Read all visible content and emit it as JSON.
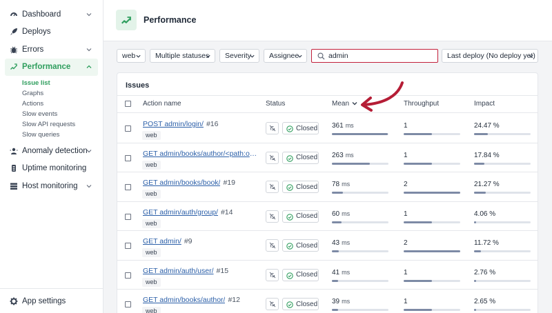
{
  "sidebar": {
    "items": [
      {
        "key": "dashboard",
        "label": "Dashboard",
        "icon": "dashboard-icon",
        "chevron": "down"
      },
      {
        "key": "deploys",
        "label": "Deploys",
        "icon": "rocket-icon",
        "chevron": ""
      },
      {
        "key": "errors",
        "label": "Errors",
        "icon": "bug-icon",
        "chevron": "down"
      },
      {
        "key": "performance",
        "label": "Performance",
        "icon": "performance-icon",
        "chevron": "up",
        "active": true
      },
      {
        "key": "anomaly",
        "label": "Anomaly detection",
        "icon": "anomaly-icon",
        "chevron": "down"
      },
      {
        "key": "uptime",
        "label": "Uptime monitoring",
        "icon": "uptime-icon",
        "chevron": ""
      },
      {
        "key": "host",
        "label": "Host monitoring",
        "icon": "host-icon",
        "chevron": "down"
      }
    ],
    "performance_subitems": [
      {
        "label": "Issue list",
        "active": true
      },
      {
        "label": "Graphs"
      },
      {
        "label": "Actions"
      },
      {
        "label": "Slow events"
      },
      {
        "label": "Slow API requests"
      },
      {
        "label": "Slow queries"
      }
    ],
    "footer": {
      "label": "App settings",
      "icon": "gear-icon"
    }
  },
  "header": {
    "title": "Performance",
    "logo_icon": "performance-logo-icon"
  },
  "filters": {
    "namespace": "web",
    "statuses": "Multiple statuses",
    "severity": "Severity",
    "assignee": "Assignee",
    "search_value": "admin",
    "deploy": "Last deploy (No deploy yet)"
  },
  "colors": {
    "accent": "#2f9e5e",
    "search_border": "#c21f3a",
    "link": "#2b5fa8",
    "bar": "#7d8aa5",
    "bar_track": "#dfe3ea"
  },
  "table": {
    "title": "Issues",
    "columns": {
      "action": "Action name",
      "status": "Status",
      "mean": "Mean",
      "throughput": "Throughput",
      "impact": "Impact"
    },
    "sorted_by": "mean",
    "sort_direction": "desc",
    "rows": [
      {
        "action": "POST admin/login/",
        "number": "#16",
        "namespace": "web",
        "status": "Closed",
        "mean": "361",
        "mean_unit": "ms",
        "mean_level": 0.99,
        "throughput": "1",
        "throughput_level": 0.5,
        "impact": "24.47 %",
        "impact_level": 0.24
      },
      {
        "action": "GET admin/books/author/<path:object_id>/change/",
        "number": "",
        "namespace": "web",
        "status": "Closed",
        "mean": "263",
        "mean_unit": "ms",
        "mean_level": 0.67,
        "throughput": "1",
        "throughput_level": 0.5,
        "impact": "17.84 %",
        "impact_level": 0.18
      },
      {
        "action": "GET admin/books/book/",
        "number": "#19",
        "namespace": "web",
        "status": "Closed",
        "mean": "78",
        "mean_unit": "ms",
        "mean_level": 0.2,
        "throughput": "2",
        "throughput_level": 1.0,
        "impact": "21.27 %",
        "impact_level": 0.21
      },
      {
        "action": "GET admin/auth/group/",
        "number": "#14",
        "namespace": "web",
        "status": "Closed",
        "mean": "60",
        "mean_unit": "ms",
        "mean_level": 0.17,
        "throughput": "1",
        "throughput_level": 0.5,
        "impact": "4.06 %",
        "impact_level": 0.04
      },
      {
        "action": "GET admin/",
        "number": "#9",
        "namespace": "web",
        "status": "Closed",
        "mean": "43",
        "mean_unit": "ms",
        "mean_level": 0.12,
        "throughput": "2",
        "throughput_level": 1.0,
        "impact": "11.72 %",
        "impact_level": 0.12
      },
      {
        "action": "GET admin/auth/user/",
        "number": "#15",
        "namespace": "web",
        "status": "Closed",
        "mean": "41",
        "mean_unit": "ms",
        "mean_level": 0.11,
        "throughput": "1",
        "throughput_level": 0.5,
        "impact": "2.76 %",
        "impact_level": 0.03
      },
      {
        "action": "GET admin/books/author/",
        "number": "#12",
        "namespace": "web",
        "status": "Closed",
        "mean": "39",
        "mean_unit": "ms",
        "mean_level": 0.11,
        "throughput": "1",
        "throughput_level": 0.5,
        "impact": "2.65 %",
        "impact_level": 0.03
      }
    ]
  },
  "annotation": {
    "icon": "arrow-annotation-icon",
    "color": "#b51d36"
  }
}
